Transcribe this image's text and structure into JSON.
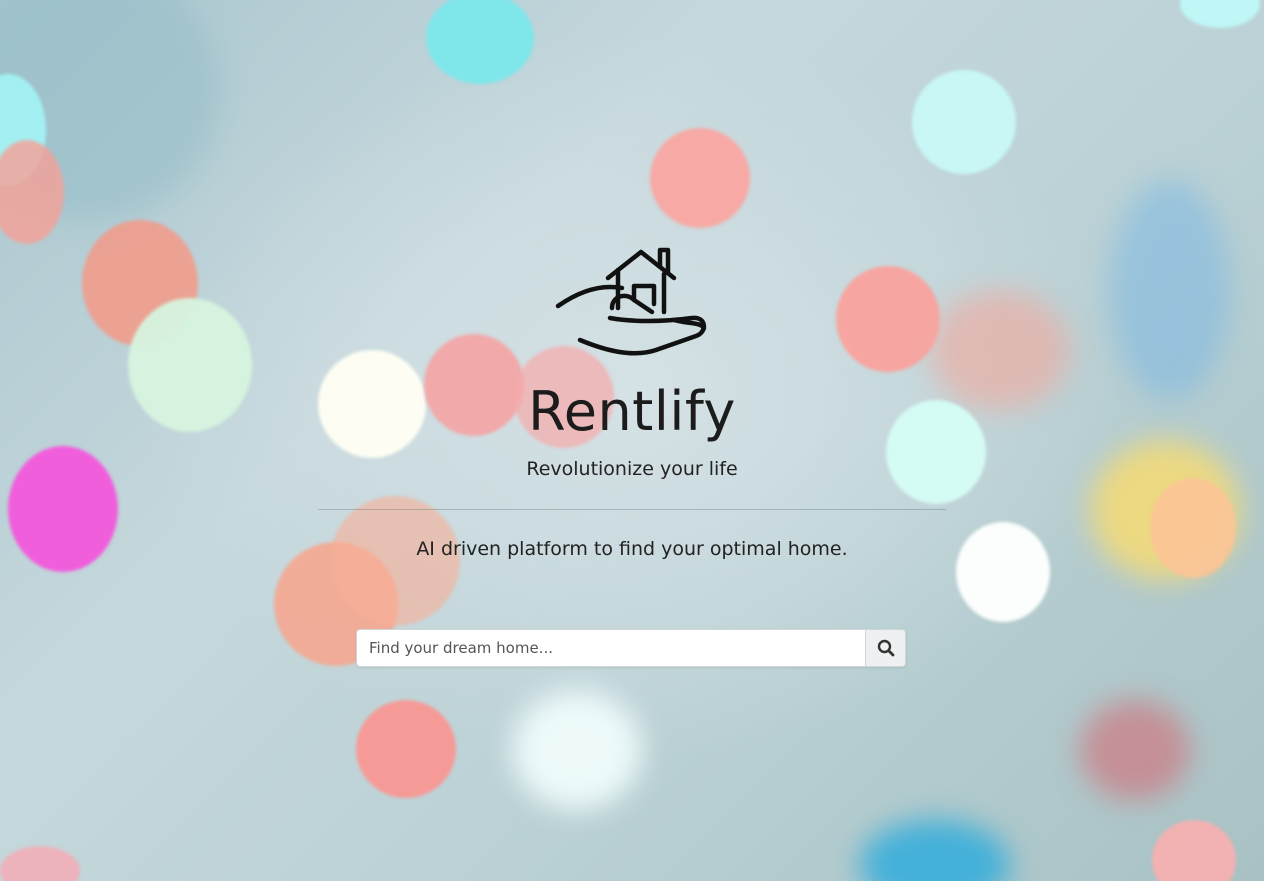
{
  "brand": {
    "name": "Rentlify",
    "tagline": "Revolutionize your life",
    "logo_icon": "house-in-hand-icon"
  },
  "hero": {
    "description": "AI driven platform to find your optimal home."
  },
  "search": {
    "placeholder": "Find your dream home...",
    "value": "",
    "button_icon": "search-icon"
  },
  "colors": {
    "text": "#1c1c1c",
    "background": "#b9d2d8",
    "input_bg": "#ffffff",
    "button_bg": "#eef0f1"
  }
}
